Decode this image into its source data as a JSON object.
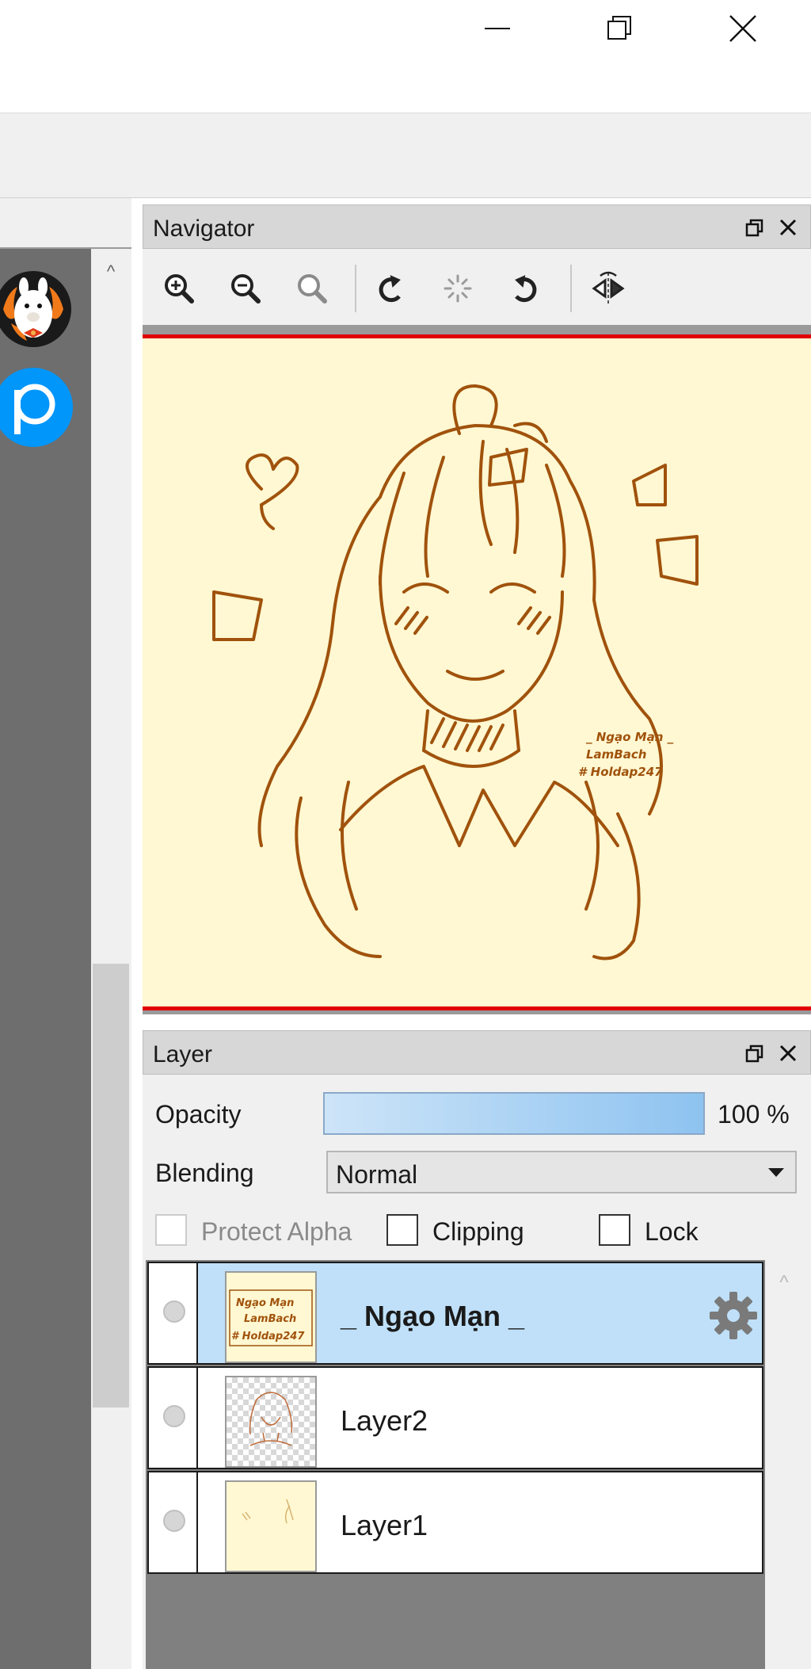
{
  "window": {
    "controls": {
      "minimize_icon": "minimize-icon",
      "restore_icon": "restore-icon",
      "close_icon": "close-icon"
    }
  },
  "sidebar": {
    "items": [
      {
        "icon": "alpaca-avatar-icon"
      },
      {
        "icon": "pixiv-icon",
        "glyph": "P"
      }
    ],
    "scroll_up_glyph": "^"
  },
  "navigator": {
    "title": "Navigator",
    "tools": [
      "zoom-in-icon",
      "zoom-out-icon",
      "zoom-reset-icon",
      "rotate-left-icon",
      "rotate-reset-icon",
      "rotate-right-icon",
      "flip-horizontal-icon"
    ],
    "preview": {
      "background": "#fff8d2",
      "line_color": "#a0520c",
      "signature": [
        "_ Ngạo Mạn _",
        "LamBach",
        "# Holdap247"
      ]
    }
  },
  "layer": {
    "title": "Layer",
    "opacity_label": "Opacity",
    "opacity_value": "100 %",
    "opacity_fraction": 1.0,
    "blending_label": "Blending",
    "blending_value": "Normal",
    "protect_alpha_label": "Protect Alpha",
    "clipping_label": "Clipping",
    "lock_label": "Lock",
    "list_scroll_glyph": "^",
    "layers": [
      {
        "name": "_ Ngạo Mạn _",
        "selected": true,
        "thumb_text": [
          "Ngạo Mạn",
          "LamBach",
          "# Holdap247"
        ]
      },
      {
        "name": "Layer2",
        "selected": false
      },
      {
        "name": "Layer1",
        "selected": false
      }
    ]
  },
  "colors": {
    "accent_red": "#e00000",
    "selection_blue": "#bfe0f8",
    "sketch_brown": "#a0520c",
    "paper": "#fff8d2"
  }
}
